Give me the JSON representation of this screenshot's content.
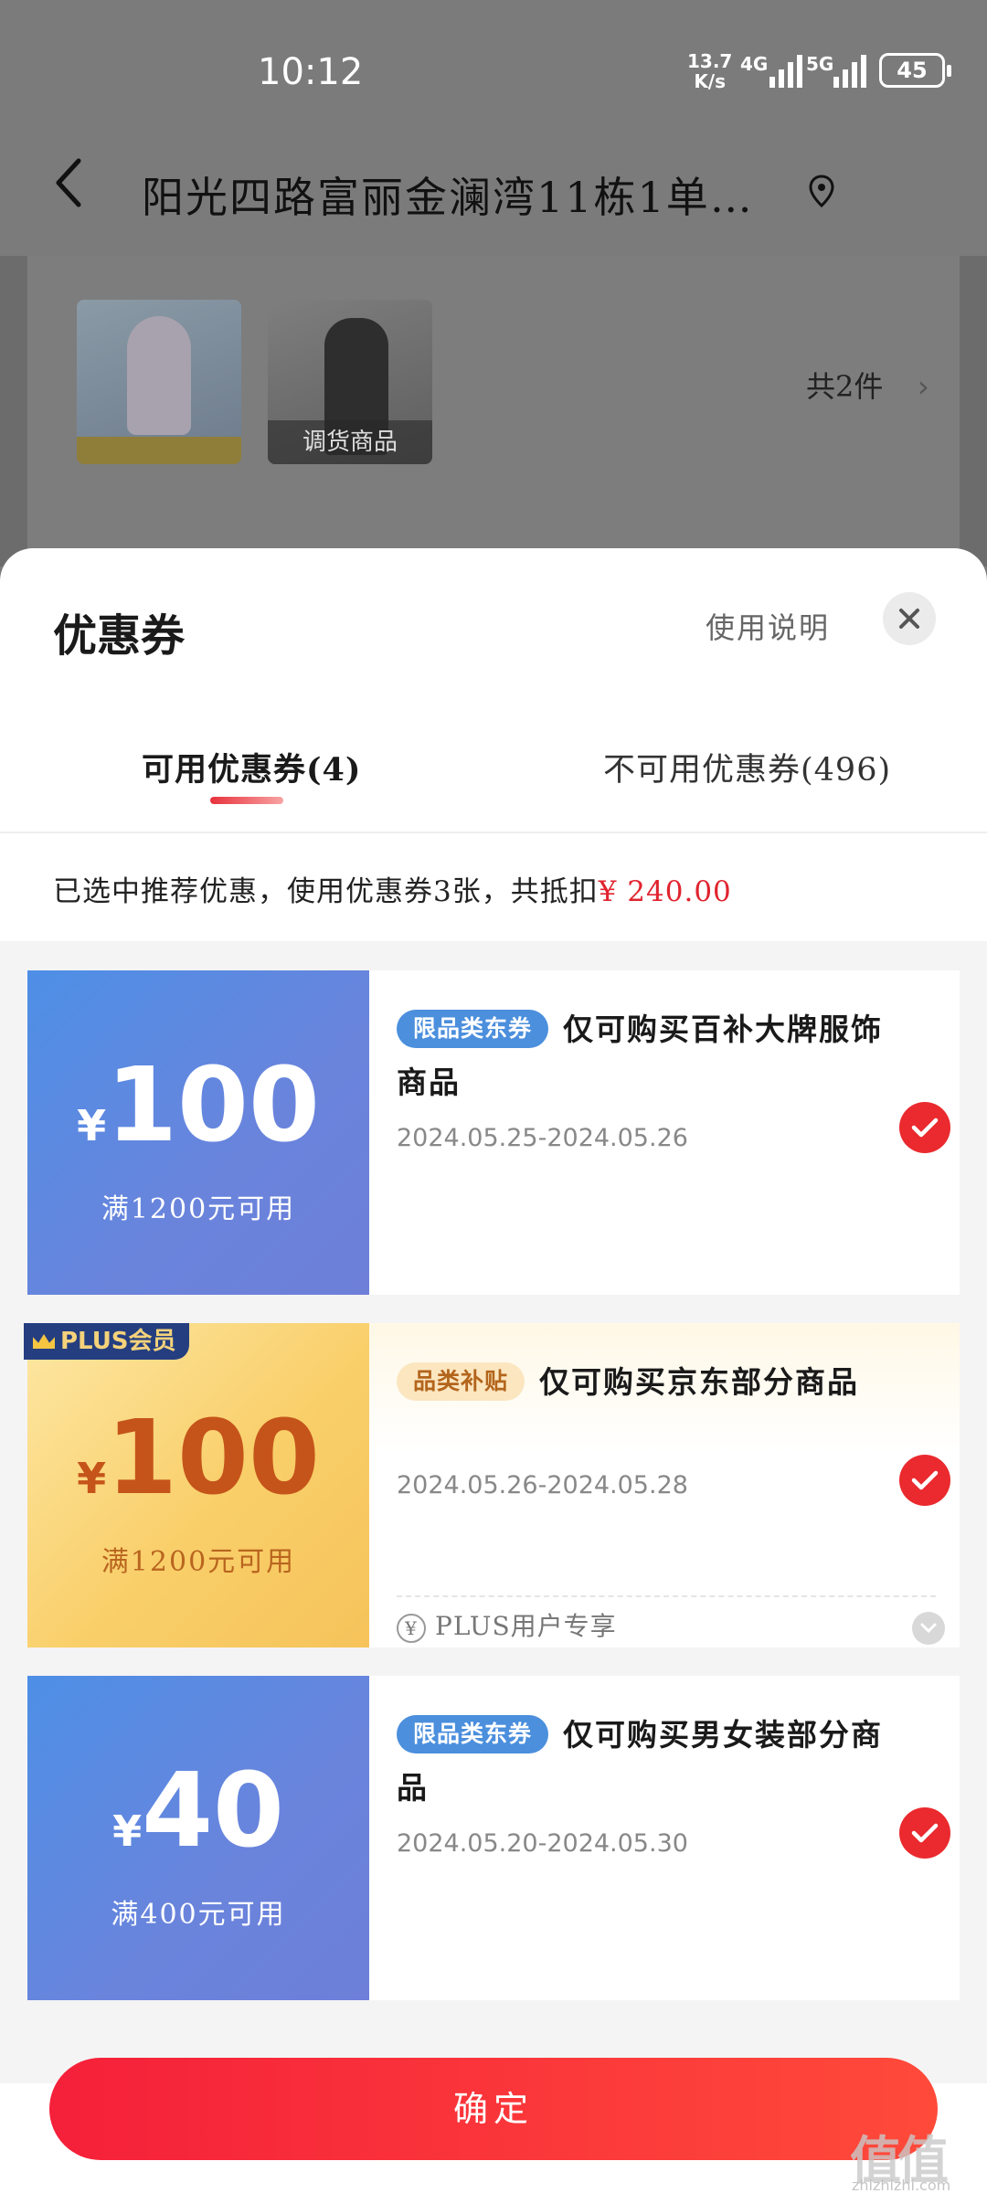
{
  "status_bar": {
    "time": "10:12",
    "net_speed_top": "13.7",
    "net_speed_unit": "K/s",
    "sig1_label": "4G",
    "sig2_label": "5G",
    "battery": "45"
  },
  "header": {
    "address": "阳光四路富丽金澜湾11栋1单…",
    "item_count_text": "共2件",
    "thumb2_overlay": "调货商品"
  },
  "sheet": {
    "title": "优惠券",
    "usage_link": "使用说明",
    "tabs": [
      {
        "label": "可用优惠券(4)",
        "active": true
      },
      {
        "label": "不可用优惠券(496)",
        "active": false
      }
    ],
    "summary_text": "已选中推荐优惠，使用优惠券3张，共抵扣",
    "summary_amount": "¥ 240.00"
  },
  "coupons": [
    {
      "currency": "¥",
      "amount": "100",
      "condition": "满1200元可用",
      "tag": "限品类东券",
      "title": "仅可购买百补大牌服饰商品",
      "date": "2024.05.25-2024.05.26",
      "selected": true,
      "style": "blue"
    },
    {
      "badge": "PLUS会员",
      "currency": "¥",
      "amount": "100",
      "condition": "满1200元可用",
      "tag": "品类补贴",
      "title": "仅可购买京东部分商品",
      "date": "2024.05.26-2024.05.28",
      "footer": "PLUS用户专享",
      "selected": true,
      "style": "gold"
    },
    {
      "currency": "¥",
      "amount": "40",
      "condition": "满400元可用",
      "tag": "限品类东券",
      "title": "仅可购买男女装部分商品",
      "date": "2024.05.20-2024.05.30",
      "selected": true,
      "style": "blue"
    }
  ],
  "confirm_label": "确定",
  "watermark": {
    "logo": "值值值",
    "site": "zhizhizhi.com"
  },
  "colors": {
    "accent_red": "#e0232e",
    "coupon_blue": "#5a8be2",
    "coupon_gold": "#f9cf6a"
  }
}
